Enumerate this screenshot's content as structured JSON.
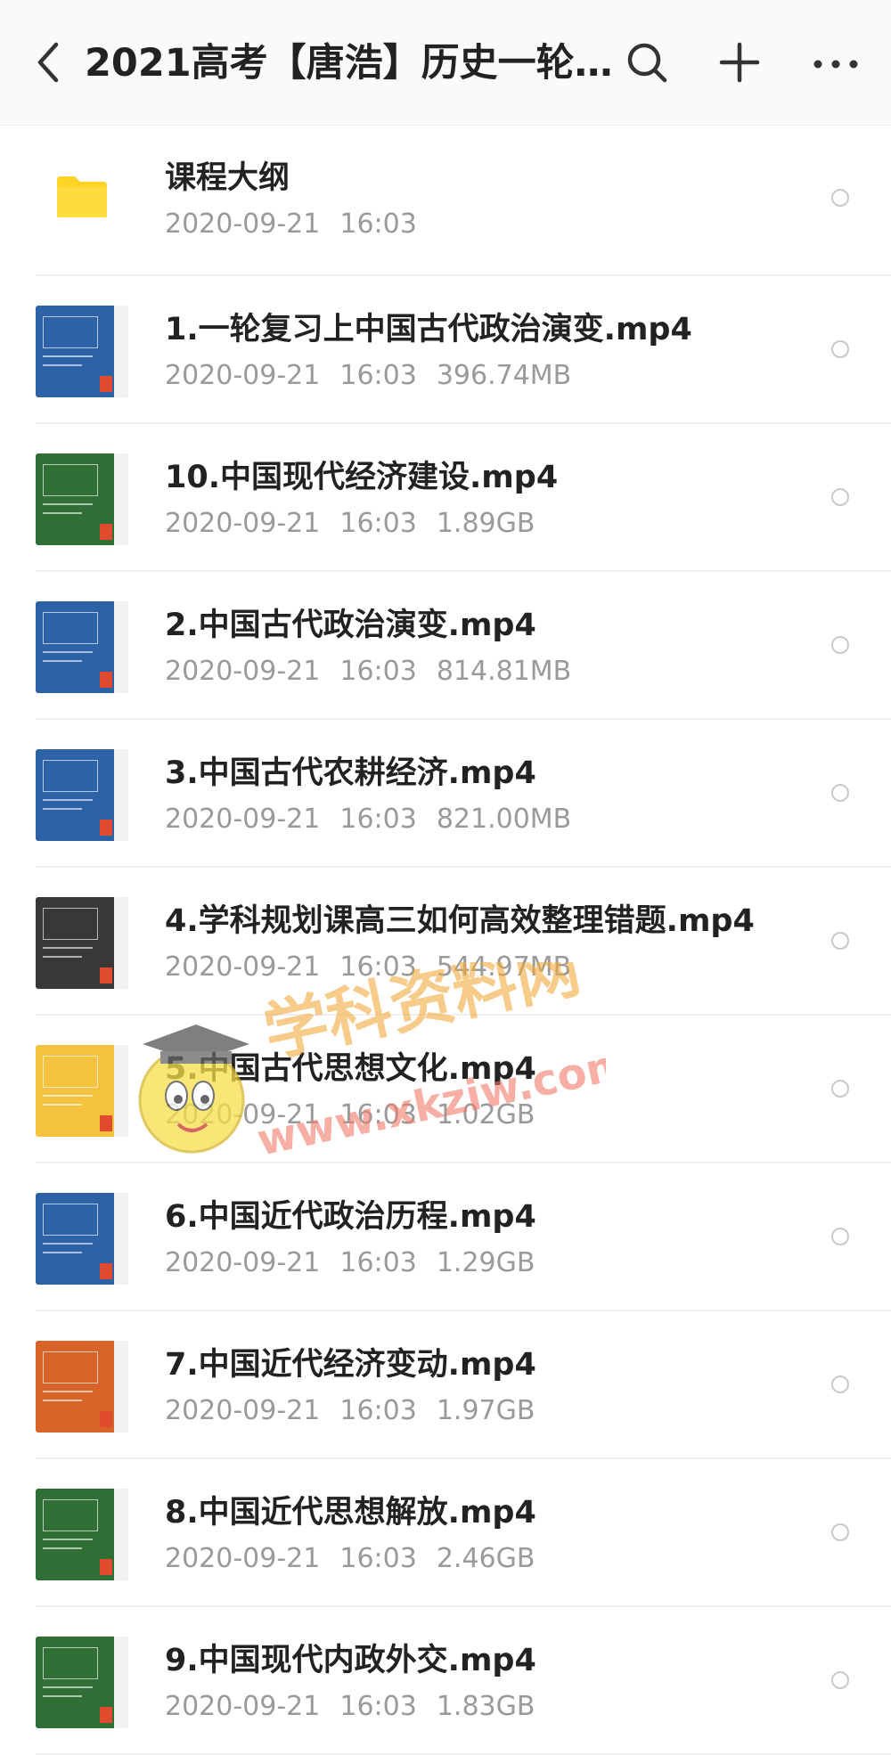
{
  "header": {
    "title": "2021高考【唐浩】历史一轮…",
    "back_icon": "chevron-left-icon",
    "search_icon": "search-icon",
    "add_icon": "plus-icon",
    "more_icon": "more-horizontal-icon"
  },
  "colors": {
    "folder": "#ffd426",
    "thumb_blue": "#2e62a6",
    "thumb_green": "#2f6e35",
    "thumb_dark": "#3a3836",
    "thumb_orange": "#d9642a",
    "thumb_yellow": "#f5c23f"
  },
  "items": [
    {
      "name": "课程大纲",
      "date": "2020-09-21",
      "time": "16:03",
      "size": "",
      "icon": "folder-icon",
      "thumb": "folder"
    },
    {
      "name": "1.一轮复习上中国古代政治演变.mp4",
      "date": "2020-09-21",
      "time": "16:03",
      "size": "396.74MB",
      "icon": "video-thumbnail",
      "thumb": "blue"
    },
    {
      "name": "10.中国现代经济建设.mp4",
      "date": "2020-09-21",
      "time": "16:03",
      "size": "1.89GB",
      "icon": "video-thumbnail",
      "thumb": "green"
    },
    {
      "name": "2.中国古代政治演变.mp4",
      "date": "2020-09-21",
      "time": "16:03",
      "size": "814.81MB",
      "icon": "video-thumbnail",
      "thumb": "blue"
    },
    {
      "name": "3.中国古代农耕经济.mp4",
      "date": "2020-09-21",
      "time": "16:03",
      "size": "821.00MB",
      "icon": "video-thumbnail",
      "thumb": "blue"
    },
    {
      "name": "4.学科规划课高三如何高效整理错题.mp4",
      "date": "2020-09-21",
      "time": "16:03",
      "size": "544.97MB",
      "icon": "video-thumbnail",
      "thumb": "dark"
    },
    {
      "name": "5.中国古代思想文化.mp4",
      "date": "2020-09-21",
      "time": "16:03",
      "size": "1.02GB",
      "icon": "video-thumbnail",
      "thumb": "yellow"
    },
    {
      "name": "6.中国近代政治历程.mp4",
      "date": "2020-09-21",
      "time": "16:03",
      "size": "1.29GB",
      "icon": "video-thumbnail",
      "thumb": "blue"
    },
    {
      "name": "7.中国近代经济变动.mp4",
      "date": "2020-09-21",
      "time": "16:03",
      "size": "1.97GB",
      "icon": "video-thumbnail",
      "thumb": "orange"
    },
    {
      "name": "8.中国近代思想解放.mp4",
      "date": "2020-09-21",
      "time": "16:03",
      "size": "2.46GB",
      "icon": "video-thumbnail",
      "thumb": "green"
    },
    {
      "name": "9.中国现代内政外交.mp4",
      "date": "2020-09-21",
      "time": "16:03",
      "size": "1.83GB",
      "icon": "video-thumbnail",
      "thumb": "green"
    }
  ],
  "watermark": {
    "text": "学科资料网",
    "url": "www.xkziw.com"
  }
}
